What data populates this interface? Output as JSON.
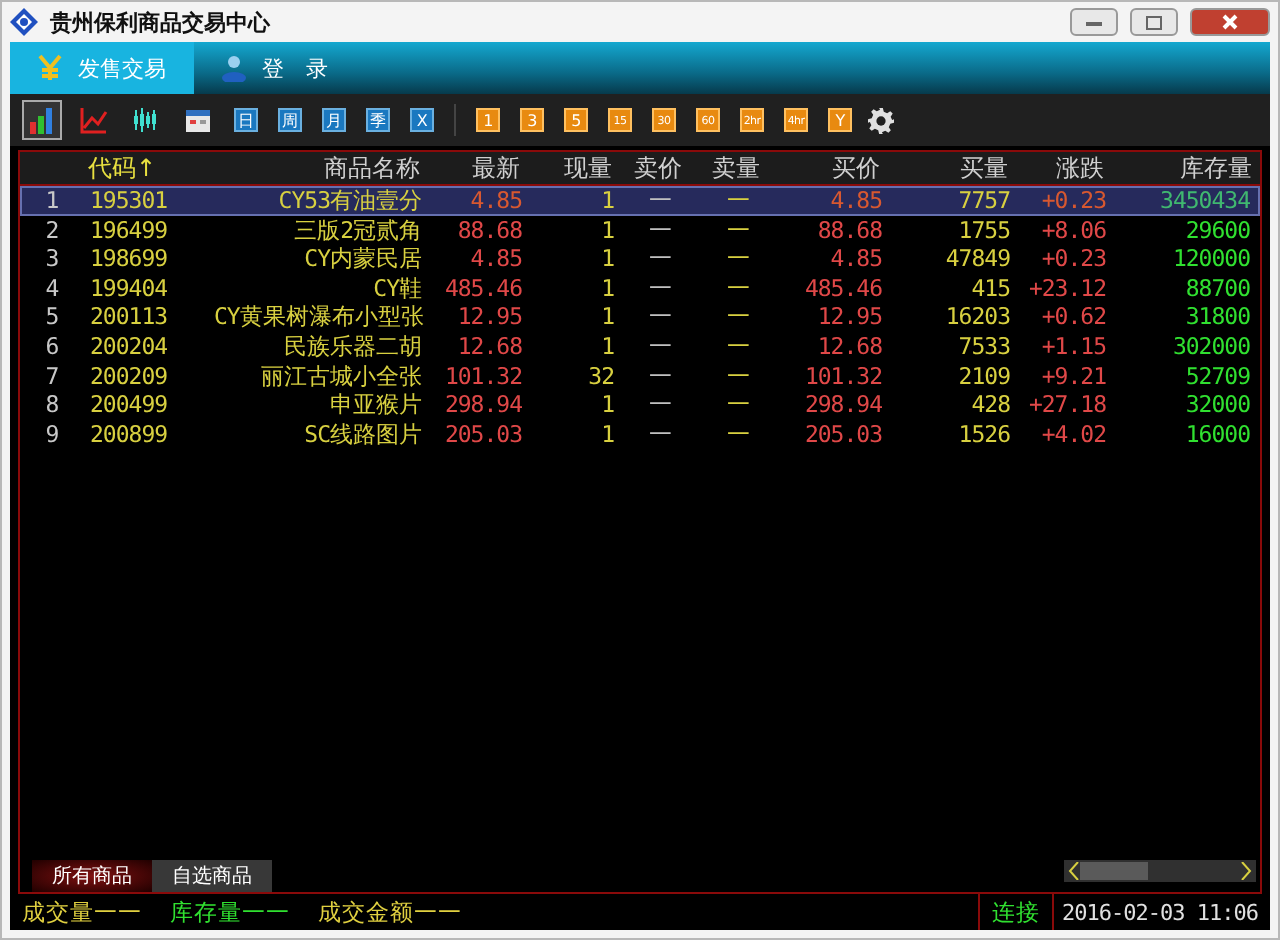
{
  "window": {
    "title": "贵州保利商品交易中心"
  },
  "tabs": [
    {
      "label": "发售交易",
      "kind": "yen",
      "selected": true
    },
    {
      "label": "登　录",
      "kind": "user",
      "selected": false
    }
  ],
  "toolbar": {
    "views": [
      {
        "kind": "bars",
        "selected": true
      },
      {
        "kind": "line",
        "selected": false
      },
      {
        "kind": "candles",
        "selected": false
      },
      {
        "kind": "calendar",
        "selected": false
      }
    ],
    "periods": [
      "日",
      "周",
      "月",
      "季",
      "X"
    ],
    "intervals": [
      "1",
      "3",
      "5",
      "15",
      "30",
      "60",
      "2hr",
      "4hr",
      "Y"
    ]
  },
  "table": {
    "columns": [
      {
        "label": "代码↑",
        "sorted": true
      },
      {
        "label": "商品名称",
        "sorted": false
      },
      {
        "label": "最新",
        "sorted": false
      },
      {
        "label": "现量",
        "sorted": false
      },
      {
        "label": "卖价",
        "sorted": false
      },
      {
        "label": "卖量",
        "sorted": false
      },
      {
        "label": "买价",
        "sorted": false
      },
      {
        "label": "买量",
        "sorted": false
      },
      {
        "label": "涨跌",
        "sorted": false
      },
      {
        "label": "库存量",
        "sorted": false
      }
    ],
    "rows": [
      {
        "selected": true,
        "index": "1",
        "cells": [
          "195301",
          "CY53有油壹分",
          "4.85",
          "1",
          "一",
          "一",
          "4.85",
          "7757",
          "+0.23",
          "3450434"
        ]
      },
      {
        "selected": false,
        "index": "2",
        "cells": [
          "196499",
          "三版2冠贰角",
          "88.68",
          "1",
          "一",
          "一",
          "88.68",
          "1755",
          "+8.06",
          "29600"
        ]
      },
      {
        "selected": false,
        "index": "3",
        "cells": [
          "198699",
          "CY内蒙民居",
          "4.85",
          "1",
          "一",
          "一",
          "4.85",
          "47849",
          "+0.23",
          "120000"
        ]
      },
      {
        "selected": false,
        "index": "4",
        "cells": [
          "199404",
          "CY鞋",
          "485.46",
          "1",
          "一",
          "一",
          "485.46",
          "415",
          "+23.12",
          "88700"
        ]
      },
      {
        "selected": false,
        "index": "5",
        "cells": [
          "200113",
          "CY黄果树瀑布小型张",
          "12.95",
          "1",
          "一",
          "一",
          "12.95",
          "16203",
          "+0.62",
          "31800"
        ]
      },
      {
        "selected": false,
        "index": "6",
        "cells": [
          "200204",
          "民族乐器二胡",
          "12.68",
          "1",
          "一",
          "一",
          "12.68",
          "7533",
          "+1.15",
          "302000"
        ]
      },
      {
        "selected": false,
        "index": "7",
        "cells": [
          "200209",
          "丽江古城小全张",
          "101.32",
          "32",
          "一",
          "一",
          "101.32",
          "2109",
          "+9.21",
          "52709"
        ]
      },
      {
        "selected": false,
        "index": "8",
        "cells": [
          "200499",
          "申亚猴片",
          "298.94",
          "1",
          "一",
          "一",
          "298.94",
          "428",
          "+27.18",
          "32000"
        ]
      },
      {
        "selected": false,
        "index": "9",
        "cells": [
          "200899",
          "SC线路图片",
          "205.03",
          "1",
          "一",
          "一",
          "205.03",
          "1526",
          "+4.02",
          "16000"
        ]
      }
    ]
  },
  "sheet_tabs": [
    {
      "label": "所有商品",
      "selected": true
    },
    {
      "label": "自选商品",
      "selected": false
    }
  ],
  "status_bar": {
    "items": [
      {
        "text": "成交量一一",
        "color": "#e0d040"
      },
      {
        "text": "库存量一一",
        "color": "#30e030"
      },
      {
        "text": "成交金额一一",
        "color": "#e0d040"
      }
    ],
    "connection": "连接",
    "datetime": "2016-02-03 11:06"
  }
}
